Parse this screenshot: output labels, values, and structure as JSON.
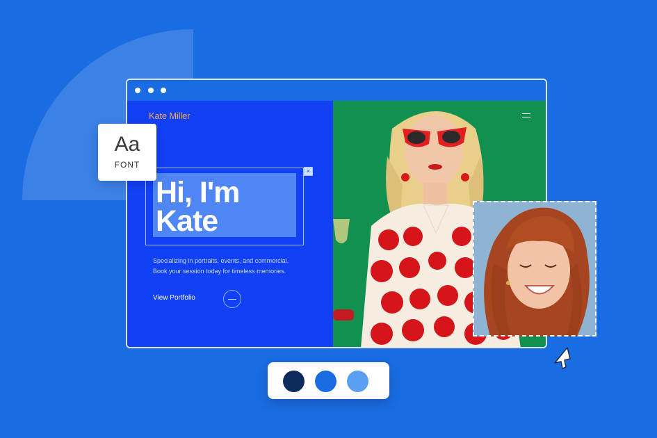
{
  "site": {
    "brand": "Kate Miller",
    "hero_line1": "Hi, I'm",
    "hero_line2": "Kate",
    "description": "Specializing in portraits, events, and commercial. Book your session today for timeless memories.",
    "cta_label": "View Portfolio",
    "selection_close_icon": "×"
  },
  "font_card": {
    "preview": "Aa",
    "label": "FONT"
  },
  "palette": {
    "swatches": [
      "#0d2a5c",
      "#1a6ce2",
      "#5a9ff2"
    ]
  },
  "colors": {
    "background": "#1a6ce2",
    "site_left": "#1240f4",
    "brand_accent": "#f2a85a",
    "photo_background": "#12904f"
  },
  "icons": {
    "font": "font-icon",
    "cursor": "cursor-arrow-icon",
    "menu": "hamburger-menu-icon",
    "arrow": "arrow-right-icon",
    "close": "close-icon"
  }
}
